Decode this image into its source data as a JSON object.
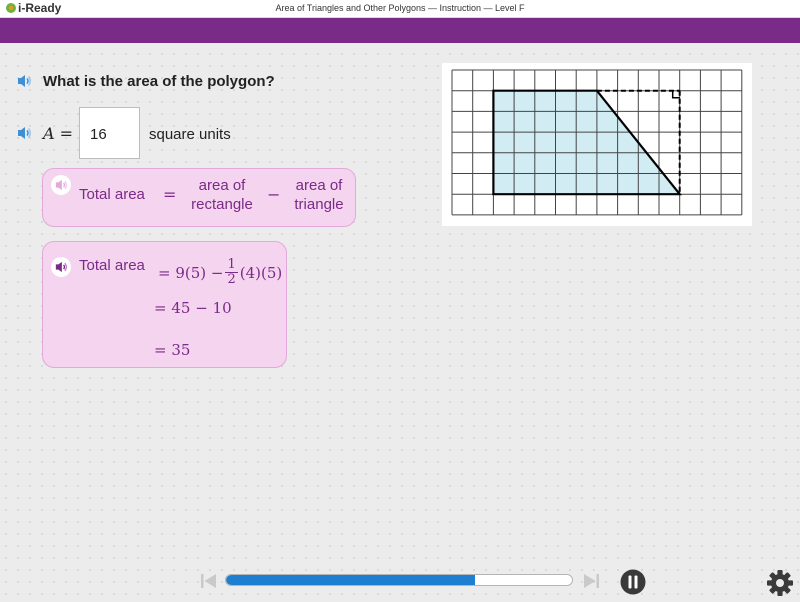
{
  "app": {
    "logo_text": "i-Ready",
    "window_title": "Area of Triangles and Other Polygons — Instruction — Level F"
  },
  "question": {
    "text": "What is the area of the polygon?"
  },
  "answer": {
    "variable": "A",
    "equals": "=",
    "value": "16",
    "units": "square units"
  },
  "formula_card": {
    "total_area": "Total area",
    "equals": "=",
    "area_rect_line1": "area of",
    "area_rect_line2": "rectangle",
    "minus": "−",
    "area_tri_line1": "area of",
    "area_tri_line2": "triangle"
  },
  "work_card": {
    "line1_label": "Total area",
    "line1_expr_a": "= 9(5) −",
    "frac_num": "1",
    "frac_den": "2",
    "line1_expr_b": "(4)(5)",
    "line2": "= 45 − 10",
    "line3": "= 35"
  },
  "figure": {
    "grid_columns": 14,
    "grid_rows": 7,
    "polygon_vertices_units": [
      [
        2,
        1
      ],
      [
        7,
        1
      ],
      [
        11,
        6
      ],
      [
        2,
        6
      ]
    ],
    "fill_color": "#d2ecf3",
    "dashed_corner_units": [
      11,
      1
    ]
  },
  "controls": {
    "progress_fraction": 0.72,
    "accent_color": "#1e7fd1",
    "icons": [
      "speaker-icon",
      "skip-back-icon",
      "skip-forward-icon",
      "pause-icon",
      "gear-icon"
    ]
  }
}
